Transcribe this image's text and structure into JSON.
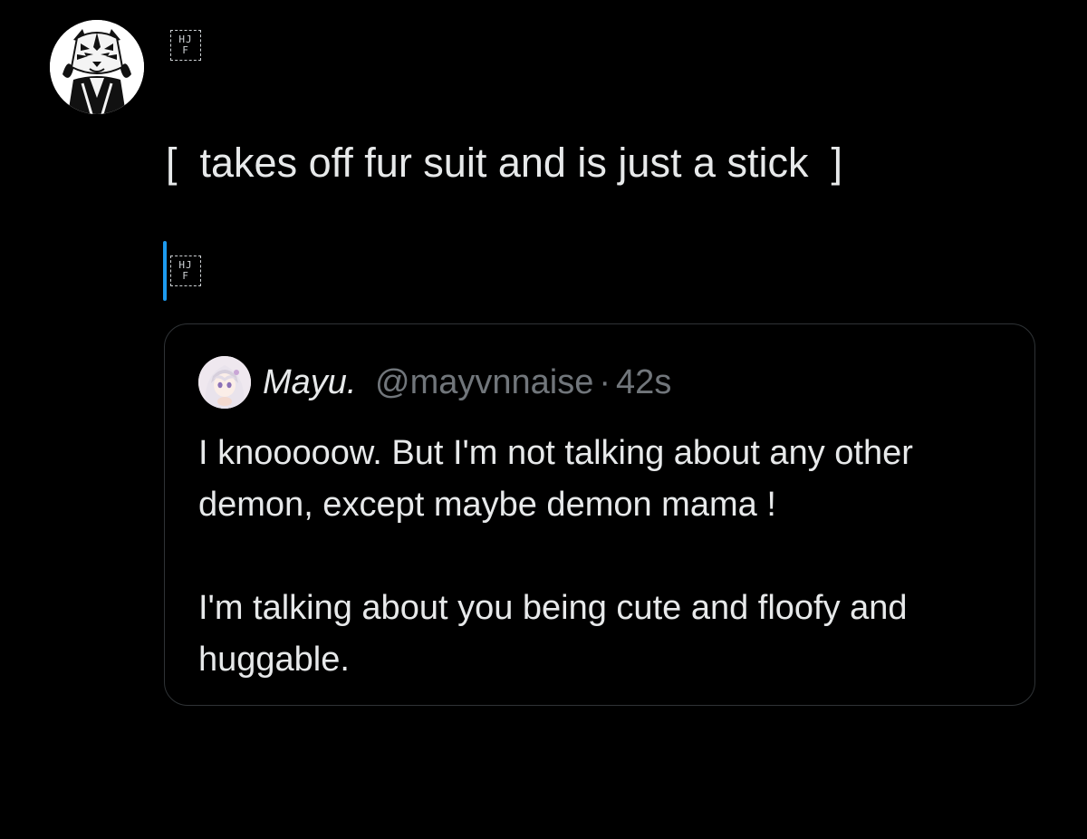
{
  "author": {
    "avatar_icon": "tiger-mask-avatar",
    "name_glyph": {
      "row1": "HJ",
      "row2": "F"
    }
  },
  "tweet": {
    "text": "[  takes off fur suit and is just a stick  ]",
    "trailing_glyph": {
      "row1": "HJ",
      "row2": "F"
    }
  },
  "quoted": {
    "avatar_icon": "anime-girl-avatar",
    "name": "Mayu.",
    "handle": "@mayvnnaise",
    "separator": "·",
    "time": "42s",
    "paragraphs": [
      "I knooooow. But I'm not talking about any other demon, except maybe demon mama !",
      "I'm talking about you being cute and floofy and huggable."
    ]
  },
  "colors": {
    "background": "#000000",
    "text": "#e7e9ea",
    "muted": "#71767b",
    "border": "#2f3336",
    "cursor": "#1d9bf0"
  }
}
